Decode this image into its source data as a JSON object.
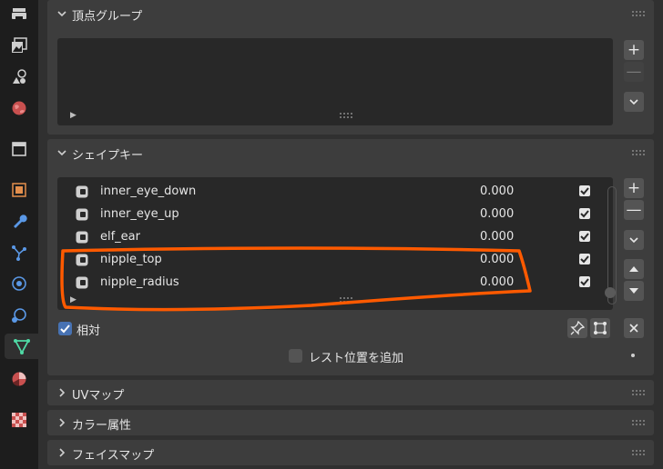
{
  "vertex_groups": {
    "title": "頂点グループ"
  },
  "shape_keys": {
    "title": "シェイプキー",
    "items": [
      {
        "name": "inner_eye_down",
        "value": "0.000",
        "enabled": true
      },
      {
        "name": "inner_eye_up",
        "value": "0.000",
        "enabled": true
      },
      {
        "name": "elf_ear",
        "value": "0.000",
        "enabled": true
      },
      {
        "name": "nipple_top",
        "value": "0.000",
        "enabled": true
      },
      {
        "name": "nipple_radius",
        "value": "0.000",
        "enabled": true
      }
    ],
    "relative_label": "相対",
    "relative_checked": true,
    "add_rest_label": "レスト位置を追加"
  },
  "collapsed_panels": {
    "uv_maps": "UVマップ",
    "color_attributes": "カラー属性",
    "face_maps": "フェイスマップ"
  },
  "buttons": {
    "plus": "+",
    "minus": "—"
  },
  "colors": {
    "accent_blue": "#4772b3",
    "annotation_orange": "#ff5a00",
    "panel": "#3d3d3d",
    "list": "#282828"
  }
}
